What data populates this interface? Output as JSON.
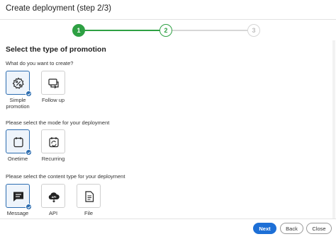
{
  "header": {
    "title": "Create deployment (step 2/3)"
  },
  "stepper": {
    "steps": [
      {
        "label": "1",
        "state": "done"
      },
      {
        "label": "2",
        "state": "current"
      },
      {
        "label": "3",
        "state": "upcoming"
      }
    ],
    "colors": {
      "active": "#2ea043",
      "inactive": "#d6d6d6"
    }
  },
  "content": {
    "title": "Select the type of promotion",
    "q1": {
      "question": "What do you want to create?",
      "options": [
        {
          "label_line1": "Simple",
          "label_line2": "promotion",
          "icon": "percent-badge-icon",
          "selected": true
        },
        {
          "label_line1": "Follow up",
          "label_line2": "",
          "icon": "follow-up-icon",
          "selected": false
        }
      ]
    },
    "q2": {
      "question": "Please select the mode for your deployment",
      "options": [
        {
          "label": "Onetime",
          "icon": "calendar-icon",
          "selected": true
        },
        {
          "label": "Recurring",
          "icon": "recurring-icon",
          "selected": false
        }
      ]
    },
    "q3": {
      "question": "Please select the content type for your deployment",
      "options": [
        {
          "label": "Message",
          "icon": "message-icon",
          "selected": true
        },
        {
          "label": "API",
          "icon": "api-cloud-icon",
          "selected": false
        },
        {
          "label": "File",
          "icon": "file-icon",
          "selected": false
        }
      ]
    }
  },
  "footer": {
    "next_label": "Next",
    "back_label": "Back",
    "close_label": "Close"
  },
  "colors": {
    "primary": "#1d6fd6",
    "selected_border": "#2b6cb0",
    "success": "#2ea043"
  }
}
